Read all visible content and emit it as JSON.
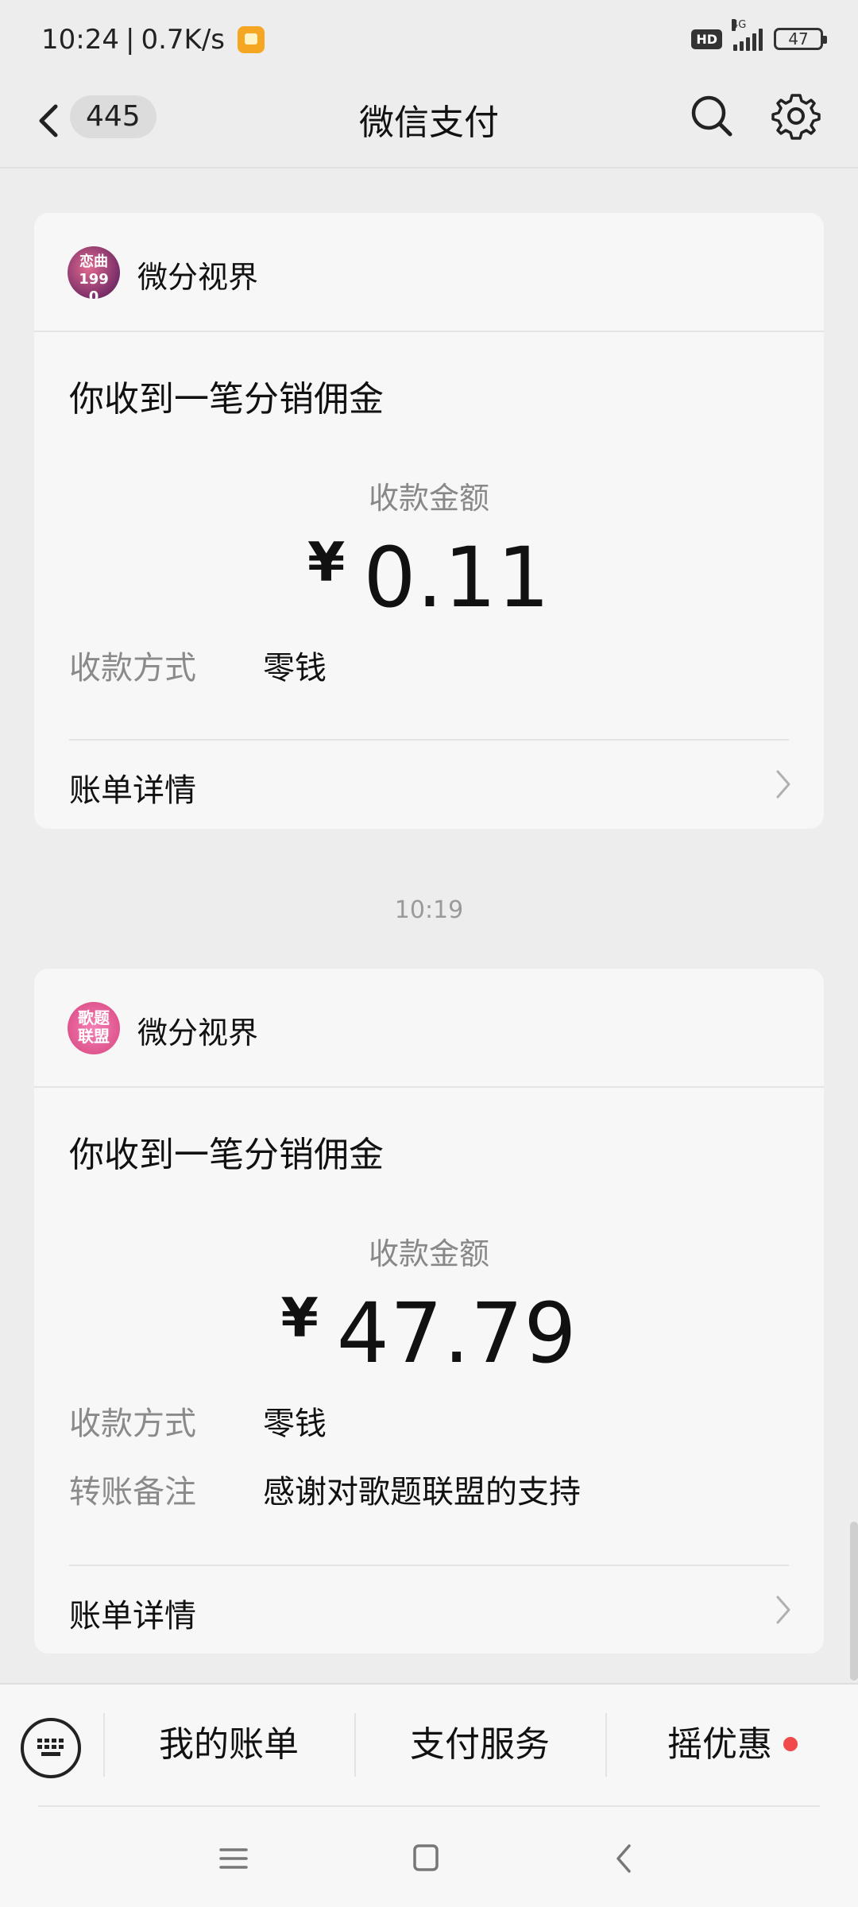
{
  "status_bar": {
    "time": "10:24",
    "network_speed": "0.7K/s",
    "hd_badge": "HD",
    "network_type": "4G",
    "battery": "47"
  },
  "nav": {
    "unread_count": "445",
    "title": "微信支付"
  },
  "messages": [
    {
      "sender": "微分视界",
      "avatar_text": "恋曲1990",
      "title": "你收到一笔分销佣金",
      "amount_label": "收款金额",
      "currency": "¥",
      "amount": "0.11",
      "method_label": "收款方式",
      "method_value": "零钱",
      "detail_label": "账单详情"
    },
    {
      "sender": "微分视界",
      "avatar_text": "歌题联盟",
      "title": "你收到一笔分销佣金",
      "amount_label": "收款金额",
      "currency": "¥",
      "amount": "47.79",
      "method_label": "收款方式",
      "method_value": "零钱",
      "remark_label": "转账备注",
      "remark_value": "感谢对歌题联盟的支持",
      "detail_label": "账单详情"
    }
  ],
  "time_separator": "10:19",
  "bottom_menu": {
    "items": [
      "我的账单",
      "支付服务",
      "摇优惠"
    ]
  },
  "colors": {
    "background": "#ededed",
    "card": "#f7f7f7",
    "badge_dot": "#f04a4a"
  }
}
